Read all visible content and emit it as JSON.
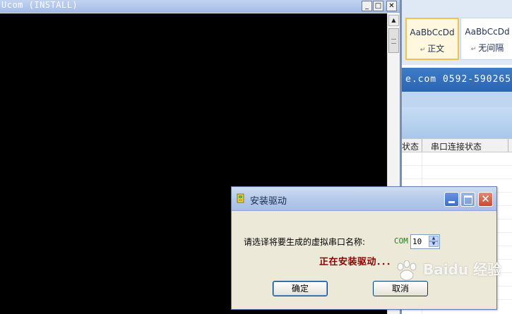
{
  "console": {
    "title": "Ucom (INSTALL)",
    "min_glyph": "_",
    "max_glyph": "□",
    "close_glyph": "✕",
    "scroll_up_glyph": "▲"
  },
  "background_doc": {
    "styles": [
      {
        "sample": "AaBbCcDd",
        "name": "正文",
        "selected": true
      },
      {
        "sample": "AaBbCcDd",
        "name": "无间隔",
        "selected": false
      }
    ],
    "paragraph_mark": "↵",
    "banner_text": "e.com  0592-590265",
    "table_headers": [
      "状态",
      "串口连接状态"
    ]
  },
  "dialog": {
    "title": "安装驱动",
    "icon": "window-app-icon",
    "prompt_label": "请选译将要生成的虚拟串口名称:",
    "com_label": "COM",
    "com_value": "10",
    "status_text": "正在安装驱动．．．",
    "ok_label": "确定",
    "cancel_label": "取消",
    "close_glyph": "✕"
  },
  "watermark": {
    "text": "Baidu 经验"
  },
  "colors": {
    "console_bg": "#000000",
    "status_red": "#8b0000",
    "com_green": "#1c7d1c",
    "dialog_bg": "#ece9d8"
  }
}
